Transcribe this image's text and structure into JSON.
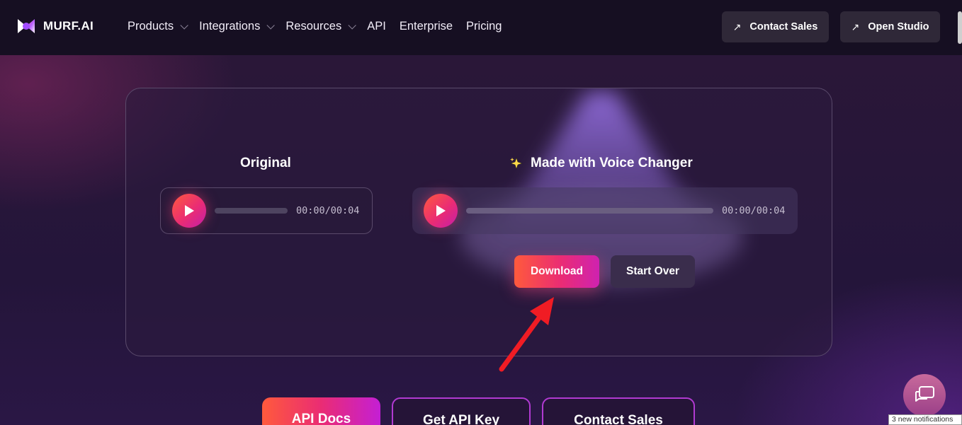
{
  "brand": {
    "name": "MURF.AI"
  },
  "nav": {
    "items": [
      {
        "label": "Products",
        "dropdown": true
      },
      {
        "label": "Integrations",
        "dropdown": true
      },
      {
        "label": "Resources",
        "dropdown": true
      },
      {
        "label": "API",
        "dropdown": false
      },
      {
        "label": "Enterprise",
        "dropdown": false
      },
      {
        "label": "Pricing",
        "dropdown": false
      }
    ],
    "contact_sales": "Contact Sales",
    "open_studio": "Open Studio"
  },
  "original": {
    "title": "Original",
    "time": "00:00/00:04",
    "progress": 0
  },
  "made": {
    "icon": "sparkles-icon",
    "title": "Made with Voice Changer",
    "time": "00:00/00:04",
    "progress": 0
  },
  "actions": {
    "download": "Download",
    "start_over": "Start Over"
  },
  "bottom": {
    "api_docs": "API Docs",
    "get_api_key": "Get API Key",
    "contact_sales": "Contact Sales"
  },
  "notifications": "3 new notifications",
  "colors": {
    "accent_start": "#ff5a3c",
    "accent_mid": "#ea2c74",
    "accent_end": "#c41fa8",
    "nav_bg": "#160f22",
    "page_bg": "#241536",
    "annotation_arrow": "#f01c24"
  }
}
